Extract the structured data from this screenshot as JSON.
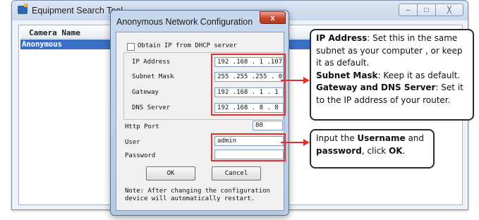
{
  "background_window": {
    "title": "Equipment Search Tool",
    "controls": [
      "–",
      "□",
      "╳"
    ],
    "column_header": "Camera Name",
    "rows": [
      "Anonymous"
    ]
  },
  "dialog": {
    "title": "Anonymous Network Configuration",
    "close_label": "x",
    "dhcp_checkbox_label": "Obtain IP from DHCP server",
    "dhcp_checked": false,
    "fields": {
      "ip_address": {
        "label": "IP Address",
        "value": "192 .168 . 1  .107"
      },
      "subnet_mask": {
        "label": "Subnet Mask",
        "value": "255 .255 .255 . 0"
      },
      "gateway": {
        "label": "Gateway",
        "value": "192 .168 . 1  . 1"
      },
      "dns_server": {
        "label": "DNS Server",
        "value": "192 .168 . 8  . 8"
      },
      "http_port": {
        "label": "Http Port",
        "value": "80"
      },
      "user": {
        "label": "User",
        "value": "admin"
      },
      "password": {
        "label": "Password",
        "value": ""
      }
    },
    "ok_label": "OK",
    "cancel_label": "Cancel",
    "note_line1": "Note: After changing the configuration",
    "note_line2": "device will automatically restart."
  },
  "callout_network": {
    "line1_bold": "IP Address",
    "line1_rest": ": Set this in the same",
    "line2": "subnet as your computer , or keep",
    "line3": "it as default.",
    "line4_bold": "Subnet Mask",
    "line4_rest": ": Keep it as default.",
    "line5_bold": "Gateway and DNS Server",
    "line5_rest": ": Set it",
    "line6": "to the IP address of your router."
  },
  "callout_login": {
    "line1_pre": "Input the ",
    "line1_bold": "Username",
    "line1_post": " and",
    "line2_bold1": "password",
    "line2_mid": ", click ",
    "line2_bold2": "OK",
    "line2_post": "."
  },
  "colors": {
    "highlight": "#e53030",
    "selection": "#3a6fc5",
    "dialog_frame": "#b3c9e6"
  }
}
